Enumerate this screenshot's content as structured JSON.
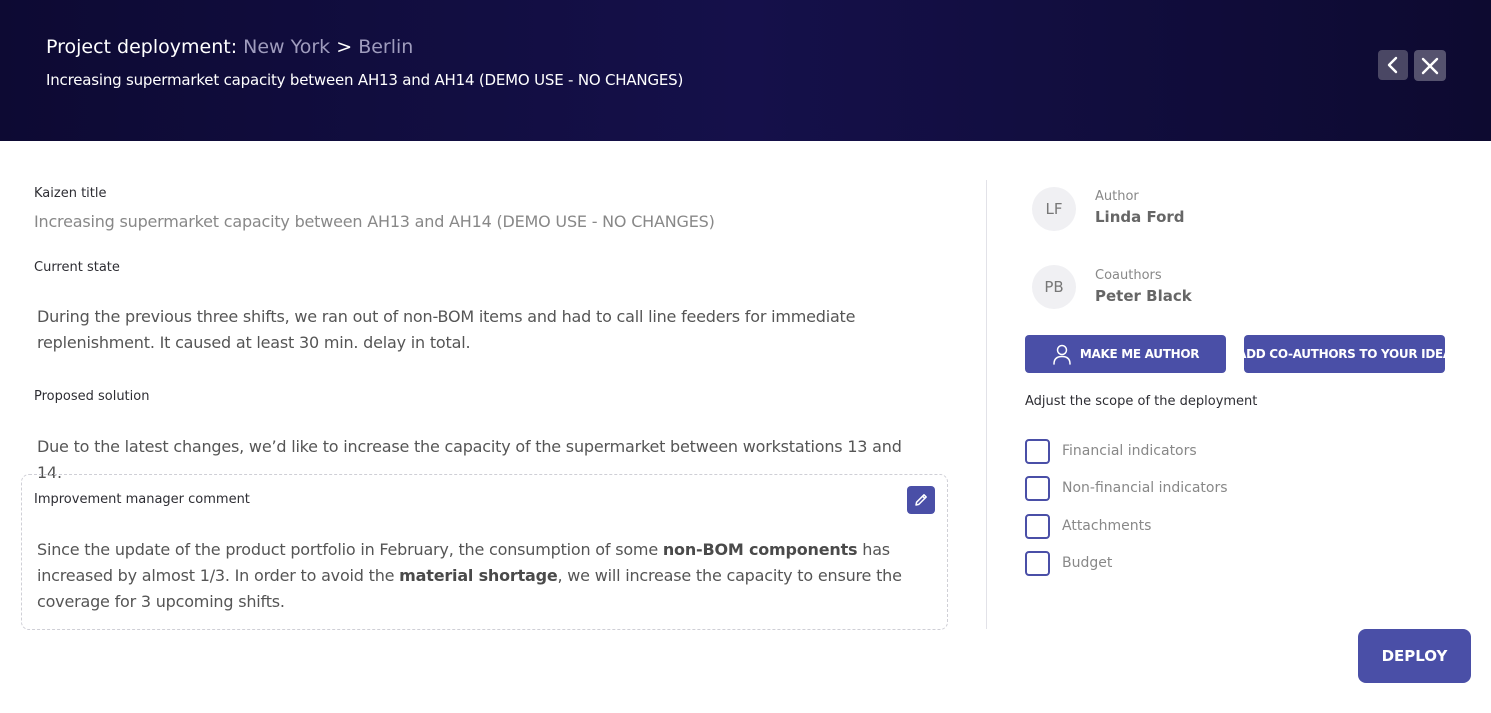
{
  "header": {
    "title_prefix": "Project deployment:",
    "route_from": "New York",
    "route_separator": ">",
    "route_to": "Berlin",
    "subtitle": "Increasing supermarket capacity between AH13 and AH14 (DEMO USE - NO CHANGES)",
    "back_icon": "chevron-left-icon",
    "close_icon": "close-icon"
  },
  "form": {
    "kaizen_title_label": "Kaizen title",
    "kaizen_title_value": "Increasing supermarket capacity between AH13 and AH14 (DEMO USE - NO CHANGES)",
    "current_state_label": "Current state",
    "current_state_value": "During the previous three shifts, we ran out of non-BOM items and had to call line feeders for immediate replenishment. It caused at least 30 min. delay in total.",
    "proposed_solution_label": "Proposed solution",
    "proposed_solution_value": "Due to the latest changes, we’d like to increase the capacity of the supermarket between workstations 13 and 14."
  },
  "comment": {
    "label": "Improvement manager comment",
    "part1": "Since the update of the product portfolio in February, the consumption of some ",
    "bold1": "non-BOM components",
    "part2": " has increased by almost 1/3. In order to avoid the ",
    "bold2": "material shortage",
    "part3": ", we will increase the capacity to ensure the coverage for 3 upcoming shifts.",
    "edit_icon": "pencil-icon"
  },
  "people": {
    "author_initials": "LF",
    "author_role": "Author",
    "author_name": "Linda Ford",
    "coauthor_initials": "PB",
    "coauthor_role": "Coauthors",
    "coauthor_name": "Peter Black"
  },
  "actions": {
    "make_me_author": "MAKE ME AUTHOR",
    "add_coauthors": "ADD CO-AUTHORS TO YOUR IDEA",
    "deploy": "DEPLOY"
  },
  "scope": {
    "title": "Adjust the scope of the deployment",
    "options": [
      {
        "label": "Financial indicators",
        "checked": false
      },
      {
        "label": "Non-financial indicators",
        "checked": false
      },
      {
        "label": "Attachments",
        "checked": false
      },
      {
        "label": "Budget",
        "checked": false
      }
    ]
  },
  "colors": {
    "primary": "#4a4fa7",
    "header_bg": "#100c3c"
  }
}
